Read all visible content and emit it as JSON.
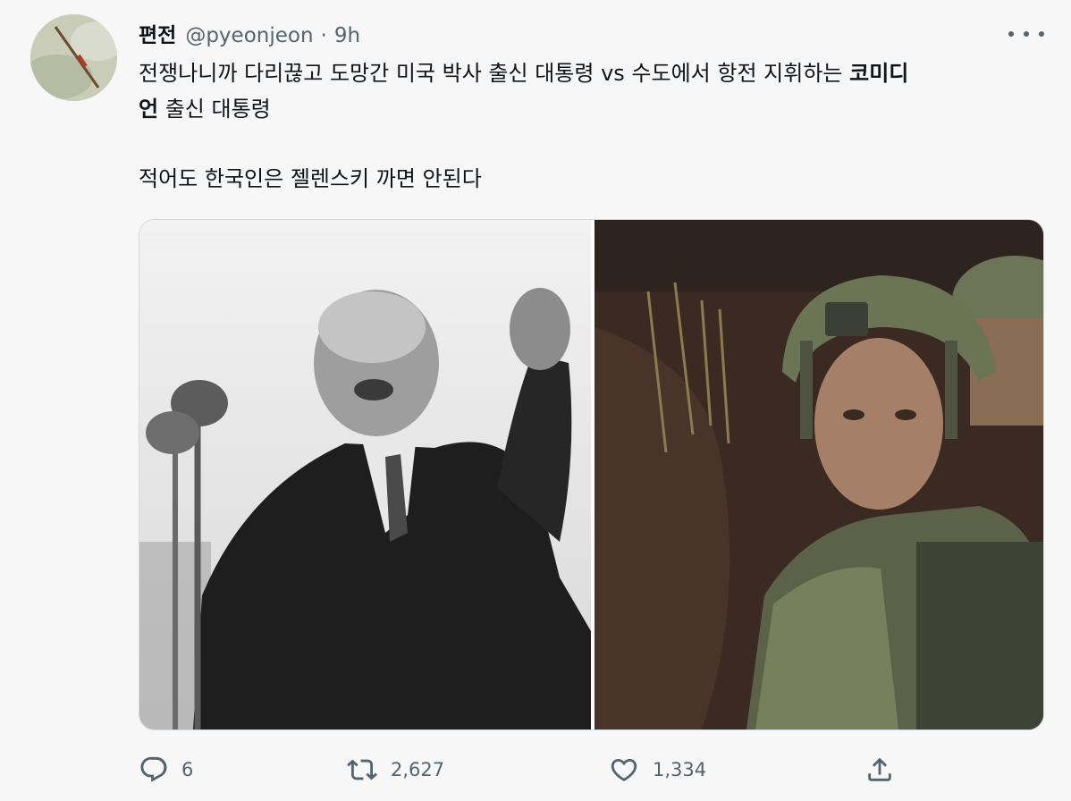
{
  "tweet": {
    "display_name": "편전",
    "handle": "@pyeonjeon",
    "separator": "·",
    "time": "9h",
    "text_line1": "전쟁나니까 다리끊고 도망간 미국 박사 출신 대통령 vs 수도에서 항전 지휘하는 ",
    "text_line1_bold": "코미디",
    "text_line2_bold": "언",
    "text_line2": " 출신 대통령",
    "text_line3": "적어도 한국인은 젤렌스키 까면 안된다"
  },
  "icons": {
    "more": "more-horizontal-icon",
    "reply": "reply-icon",
    "retweet": "retweet-icon",
    "like": "heart-icon",
    "share": "share-icon"
  },
  "actions": {
    "replies": "6",
    "retweets": "2,627",
    "likes": "1,334"
  },
  "colors": {
    "secondary_text": "#536471",
    "border": "#cfd9de",
    "text": "#0f1419"
  }
}
